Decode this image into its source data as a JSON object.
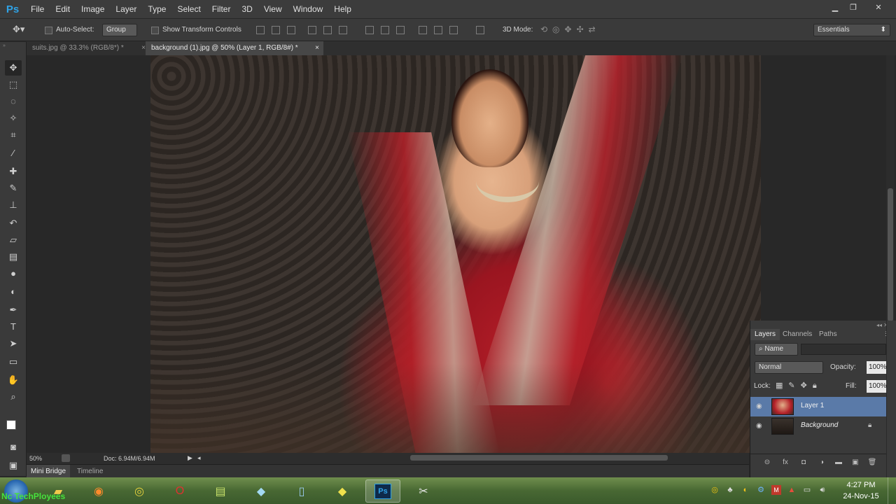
{
  "app": {
    "logo": "Ps",
    "accent": "#2fa3e7"
  },
  "menu": [
    "File",
    "Edit",
    "Image",
    "Layer",
    "Type",
    "Select",
    "Filter",
    "3D",
    "View",
    "Window",
    "Help"
  ],
  "options": {
    "auto_select_label": "Auto-Select:",
    "auto_select_value": "Group",
    "transform_label": "Show Transform Controls",
    "mode3d_label": "3D Mode:",
    "workspace": "Essentials"
  },
  "tabs": [
    {
      "label": "suits.jpg @ 33.3% (RGB/8*) *",
      "close": "×",
      "active": false
    },
    {
      "label": "background (1).jpg @ 50% (Layer 1, RGB/8#) *",
      "close": "×",
      "active": true
    }
  ],
  "status": {
    "zoom": "50%",
    "doc": "Doc: 6.94M/6.94M"
  },
  "bottom_tabs": [
    "Mini Bridge",
    "Timeline"
  ],
  "layers_panel": {
    "tabs": [
      "Layers",
      "Channels",
      "Paths"
    ],
    "filter_kind": "Name",
    "blend_mode": "Normal",
    "opacity_label": "Opacity:",
    "opacity_value": "100%",
    "lock_label": "Lock:",
    "fill_label": "Fill:",
    "fill_value": "100%",
    "layers": [
      {
        "name": "Layer 1",
        "selected": true
      },
      {
        "name": "Background",
        "selected": false
      }
    ]
  },
  "taskbar": {
    "time": "4:27 PM",
    "date": "24-Nov-15",
    "watermark": "Nc TechPloyees"
  }
}
